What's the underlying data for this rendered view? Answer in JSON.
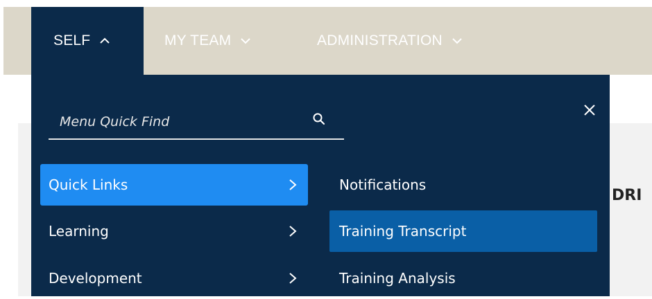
{
  "topnav": {
    "items": [
      {
        "label": "SELF",
        "state": "expanded"
      },
      {
        "label": "MY TEAM",
        "state": "collapsed"
      },
      {
        "label": "ADMINISTRATION",
        "state": "collapsed"
      }
    ]
  },
  "background": {
    "partial_heading": "DRI"
  },
  "dropdown": {
    "search": {
      "placeholder": "Menu Quick Find",
      "value": ""
    },
    "left_menu": [
      {
        "label": "Quick Links",
        "active": true
      },
      {
        "label": "Learning",
        "active": false
      },
      {
        "label": "Development",
        "active": false
      }
    ],
    "right_menu": [
      {
        "label": "Notifications",
        "highlighted": false
      },
      {
        "label": "Training Transcript",
        "highlighted": true
      },
      {
        "label": "Training Analysis",
        "highlighted": false
      }
    ]
  },
  "colors": {
    "nav_background": "#dcd7c9",
    "dropdown_background": "#0b2a4a",
    "active_item": "#1f8cf2",
    "highlight_item": "#0a5fa6"
  },
  "icons": {
    "nav_expanded": "chevron-up-icon",
    "nav_collapsed": "chevron-down-icon",
    "search": "search-icon",
    "close": "close-icon",
    "submenu": "chevron-right-icon"
  }
}
